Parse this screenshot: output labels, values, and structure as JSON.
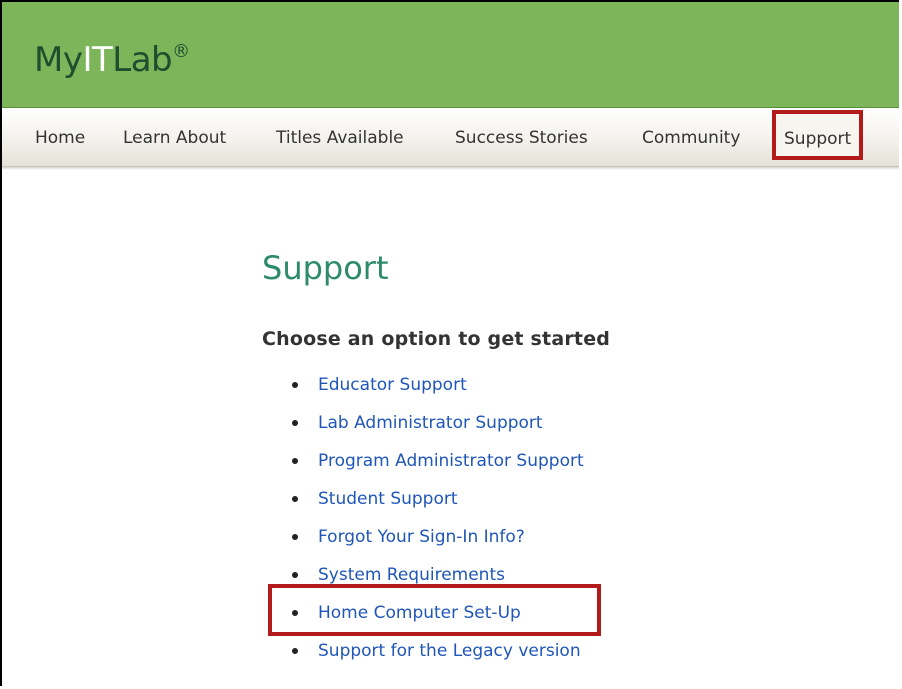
{
  "brand": {
    "name_part1": "My",
    "name_part2": "IT",
    "name_part3": "Lab",
    "registered": "®"
  },
  "nav": {
    "items": [
      {
        "label": "Home"
      },
      {
        "label": "Learn About"
      },
      {
        "label": "Titles Available"
      },
      {
        "label": "Success Stories"
      },
      {
        "label": "Community"
      },
      {
        "label": "Support"
      }
    ],
    "active": "Support"
  },
  "main": {
    "title": "Support",
    "subtitle": "Choose an option to get started",
    "links": [
      {
        "label": "Educator Support"
      },
      {
        "label": "Lab Administrator Support"
      },
      {
        "label": "Program Administrator Support"
      },
      {
        "label": "Student Support"
      },
      {
        "label": "Forgot Your Sign-In Info?"
      },
      {
        "label": "System Requirements"
      },
      {
        "label": "Home Computer Set-Up"
      },
      {
        "label": "Support for the Legacy version"
      }
    ],
    "highlighted_link": "Home Computer Set-Up"
  },
  "colors": {
    "header_green": "#7db65a",
    "title_green": "#2e8b6a",
    "link_blue": "#1f56b8",
    "highlight_red": "#b31b1b"
  }
}
